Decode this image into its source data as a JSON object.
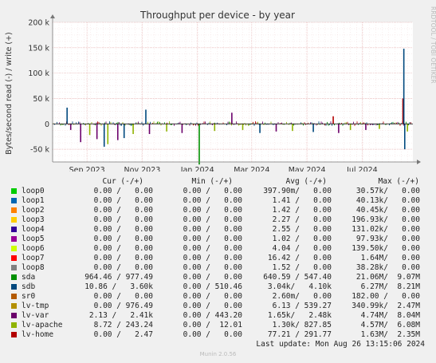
{
  "chart_data": {
    "type": "line",
    "title": "Throughput per device - by year",
    "ylabel": "Bytes/second read (-) / write (+)",
    "ylim": [
      -75000,
      200000
    ],
    "yticks": [
      -50000,
      0,
      50000,
      100000,
      150000,
      200000
    ],
    "ytick_labels": [
      "-50 k",
      "0",
      "50 k",
      "100 k",
      "150 k",
      "200 k"
    ],
    "xlim": [
      "2023-07-25",
      "2024-08-26"
    ],
    "xtick_labels": [
      "Sep 2023",
      "Nov 2023",
      "Jan 2024",
      "Mar 2024",
      "May 2024",
      "Jul 2024"
    ],
    "xticks": [
      "2023-09-01",
      "2023-11-01",
      "2024-01-01",
      "2024-03-01",
      "2024-05-01",
      "2024-07-01"
    ],
    "grid": true,
    "series": [
      {
        "name": "loop0",
        "color": "#00cc00",
        "cur": "0.00 /   0.00",
        "min": "0.00 /   0.00",
        "avg": "397.90m/   0.00",
        "max": "30.57k/   0.00"
      },
      {
        "name": "loop1",
        "color": "#0066b3",
        "cur": "0.00 /   0.00",
        "min": "0.00 /   0.00",
        "avg": "1.41 /   0.00",
        "max": "40.13k/   0.00"
      },
      {
        "name": "loop2",
        "color": "#ff8000",
        "cur": "0.00 /   0.00",
        "min": "0.00 /   0.00",
        "avg": "1.42 /   0.00",
        "max": "40.45k/   0.00"
      },
      {
        "name": "loop3",
        "color": "#ffcc00",
        "cur": "0.00 /   0.00",
        "min": "0.00 /   0.00",
        "avg": "2.27 /   0.00",
        "max": "196.93k/   0.00"
      },
      {
        "name": "loop4",
        "color": "#330099",
        "cur": "0.00 /   0.00",
        "min": "0.00 /   0.00",
        "avg": "2.55 /   0.00",
        "max": "131.02k/   0.00"
      },
      {
        "name": "loop5",
        "color": "#990099",
        "cur": "0.00 /   0.00",
        "min": "0.00 /   0.00",
        "avg": "1.02 /   0.00",
        "max": "97.93k/   0.00"
      },
      {
        "name": "loop6",
        "color": "#ccff00",
        "cur": "0.00 /   0.00",
        "min": "0.00 /   0.00",
        "avg": "4.04 /   0.00",
        "max": "139.50k/   0.00"
      },
      {
        "name": "loop7",
        "color": "#ff0000",
        "cur": "0.00 /   0.00",
        "min": "0.00 /   0.00",
        "avg": "16.42 /   0.00",
        "max": "1.64M/   0.00"
      },
      {
        "name": "loop8",
        "color": "#808080",
        "cur": "0.00 /   0.00",
        "min": "0.00 /   0.00",
        "avg": "1.52 /   0.00",
        "max": "38.28k/   0.00"
      },
      {
        "name": "sda",
        "color": "#008f00",
        "cur": "964.46 / 977.49",
        "min": "0.00 /   0.00",
        "avg": "640.59 / 547.40",
        "max": "21.06M/  9.07M"
      },
      {
        "name": "sdb",
        "color": "#00487d",
        "cur": "10.86 /   3.60k",
        "min": "0.00 / 510.46",
        "avg": "3.04k/   4.10k",
        "max": "6.27M/  8.21M"
      },
      {
        "name": "sr0",
        "color": "#b35a00",
        "cur": "0.00 /   0.00",
        "min": "0.00 /   0.00",
        "avg": "2.60m/   0.00",
        "max": "182.00 /   0.00"
      },
      {
        "name": "lv-tmp",
        "color": "#b38f00",
        "cur": "0.00 / 976.49",
        "min": "0.00 /   0.00",
        "avg": "6.13 / 539.27",
        "max": "340.99k/  2.47M"
      },
      {
        "name": "lv-var",
        "color": "#6b006b",
        "cur": "2.13 /   2.41k",
        "min": "0.00 / 443.20",
        "avg": "1.65k/   2.48k",
        "max": "4.74M/  8.04M"
      },
      {
        "name": "lv-apache",
        "color": "#8fb300",
        "cur": "8.72 / 243.24",
        "min": "0.00 /  12.01",
        "avg": "1.30k/ 827.85",
        "max": "4.57M/  6.08M"
      },
      {
        "name": "lv-home",
        "color": "#b30000",
        "cur": "0.00 /   2.47",
        "min": "0.00 /   0.00",
        "avg": "77.21 / 291.77",
        "max": "1.63M/  2.35M"
      }
    ],
    "spikes": [
      {
        "date": "2023-08-10",
        "series": "sdb",
        "value": 32000
      },
      {
        "date": "2023-08-14",
        "series": "lv-var",
        "value": -12000
      },
      {
        "date": "2023-08-25",
        "series": "lv-var",
        "value": -36000
      },
      {
        "date": "2023-09-04",
        "series": "lv-apache",
        "value": -22000
      },
      {
        "date": "2023-09-12",
        "series": "lv-var",
        "value": -30000
      },
      {
        "date": "2023-09-20",
        "series": "sdb",
        "value": -45000
      },
      {
        "date": "2023-09-24",
        "series": "lv-apache",
        "value": -40000
      },
      {
        "date": "2023-10-05",
        "series": "lv-var",
        "value": -32000
      },
      {
        "date": "2023-10-12",
        "series": "sdb",
        "value": -28000
      },
      {
        "date": "2023-10-22",
        "series": "lv-apache",
        "value": -20000
      },
      {
        "date": "2023-11-05",
        "series": "sdb",
        "value": 28000
      },
      {
        "date": "2023-11-09",
        "series": "lv-var",
        "value": -20000
      },
      {
        "date": "2023-11-28",
        "series": "lv-apache",
        "value": -15000
      },
      {
        "date": "2023-12-15",
        "series": "lv-var",
        "value": -18000
      },
      {
        "date": "2024-01-03",
        "series": "sda",
        "value": -80000
      },
      {
        "date": "2024-01-20",
        "series": "lv-apache",
        "value": -14000
      },
      {
        "date": "2024-02-08",
        "series": "lv-var",
        "value": 22000
      },
      {
        "date": "2024-02-20",
        "series": "lv-apache",
        "value": -12000
      },
      {
        "date": "2024-03-10",
        "series": "sdb",
        "value": -18000
      },
      {
        "date": "2024-03-28",
        "series": "lv-var",
        "value": -15000
      },
      {
        "date": "2024-04-15",
        "series": "lv-apache",
        "value": -14000
      },
      {
        "date": "2024-05-08",
        "series": "sdb",
        "value": -16000
      },
      {
        "date": "2024-05-30",
        "series": "lv-home",
        "value": 15000
      },
      {
        "date": "2024-06-05",
        "series": "lv-var",
        "value": -18000
      },
      {
        "date": "2024-06-18",
        "series": "lv-apache",
        "value": -12000
      },
      {
        "date": "2024-07-05",
        "series": "lv-var",
        "value": -12000
      },
      {
        "date": "2024-07-20",
        "series": "lv-apache",
        "value": -10000
      },
      {
        "date": "2024-08-15",
        "series": "lv-home",
        "value": 50000
      },
      {
        "date": "2024-08-16",
        "series": "sdb",
        "value": 148000
      },
      {
        "date": "2024-08-17",
        "series": "sdb",
        "value": -50000
      },
      {
        "date": "2024-08-20",
        "series": "lv-apache",
        "value": -15000
      }
    ]
  },
  "legend_header": {
    "cur": "Cur (-/+)",
    "min": "Min (-/+)",
    "avg": "Avg (-/+)",
    "max": "Max (-/+)"
  },
  "last_update": "Last update: Mon Aug 26 13:15:06 2024",
  "munin_version": "Munin 2.0.56",
  "rrdtool_credit": "RRDTOOL / TOBI OETIKER"
}
